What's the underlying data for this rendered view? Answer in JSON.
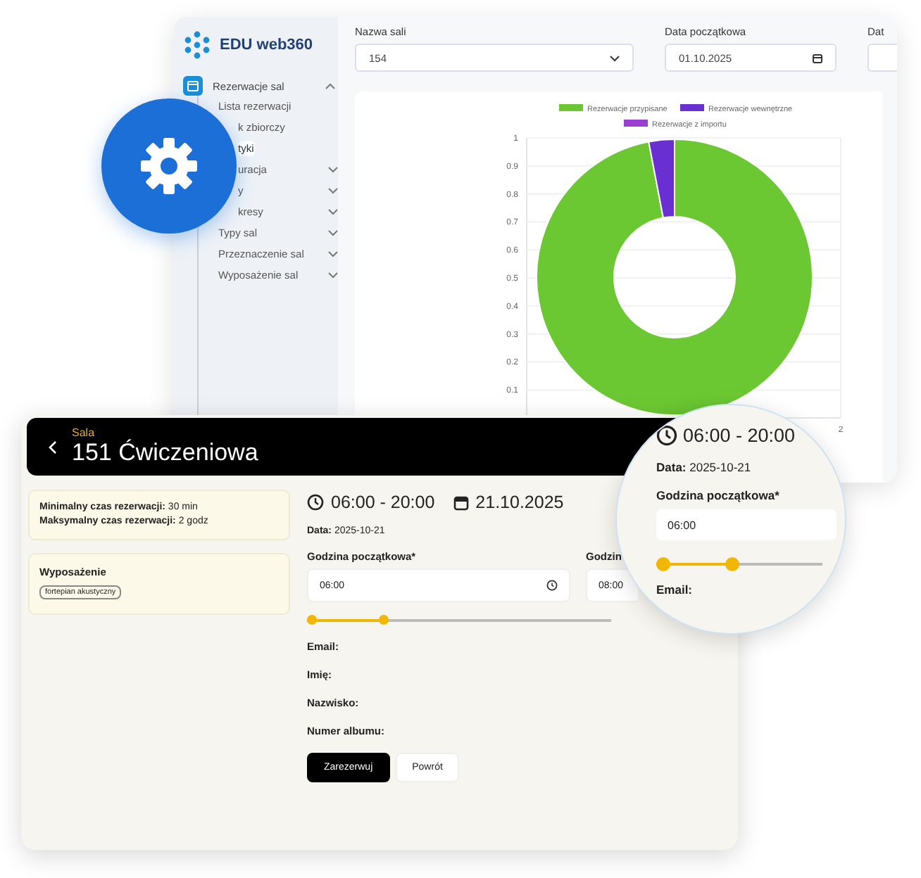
{
  "back_window": {
    "logo": "EDU web360",
    "sidebar": {
      "section": {
        "label": "Rezerwacje sal",
        "expanded": true,
        "children": [
          {
            "kind": "link",
            "label": "Lista rezerwacji",
            "selected": false,
            "covered": false
          },
          {
            "kind": "link",
            "label": "k zbiorczy",
            "selected": false,
            "covered": true
          },
          {
            "kind": "link",
            "label": "tyki",
            "selected": true,
            "covered": true
          },
          {
            "kind": "group",
            "label": "uracja",
            "selected": false,
            "covered": true
          },
          {
            "kind": "group",
            "label": "y",
            "selected": false,
            "covered": true
          },
          {
            "kind": "group",
            "label": "kresy",
            "selected": false,
            "covered": true
          },
          {
            "kind": "group",
            "label": "Typy sal",
            "selected": false,
            "covered": false
          },
          {
            "kind": "group",
            "label": "Przeznaczenie sal",
            "selected": false,
            "covered": false
          },
          {
            "kind": "group",
            "label": "Wyposażenie sal",
            "selected": false,
            "covered": false
          }
        ]
      }
    },
    "filters": [
      {
        "kind": "select",
        "label": "Nazwa sali",
        "value": "154"
      },
      {
        "kind": "date",
        "label": "Data początkowa",
        "value": "01.10.2025"
      },
      {
        "kind": "cut",
        "label": "Dat"
      }
    ],
    "chart": {
      "chart_data": {
        "type": "donut",
        "categories": [
          "Rezerwacje przypisane",
          "Rezerwacje wewnętrzne",
          "Rezerwacje z importu"
        ],
        "colors": [
          "#6cc832",
          "#6a2fd0",
          "#9b3fd0"
        ],
        "values": [
          0.97,
          0.03,
          0
        ],
        "legend": "top"
      },
      "axis_ticks": [
        "1",
        "0.9",
        "0.8",
        "0.7",
        "0.6",
        "0.5",
        "0.4",
        "0.3",
        "0.2",
        "0.1"
      ],
      "corner_tick": "2"
    }
  },
  "front_window": {
    "header": {
      "subtitle": "Sala",
      "title": "151 Ćwiczeniowa"
    },
    "info_cards": [
      {
        "kind": "limits",
        "lines": [
          "**Minimalny czas rezerwacji:** 30 min",
          "**Maksymalny czas rezerwacji:** 2 godz"
        ]
      },
      {
        "kind": "equipment",
        "title": "Wyposażenie",
        "tags": [
          "fortepian akustyczny"
        ]
      }
    ],
    "hours": "06:00 - 20:00",
    "date": "21.10.2025",
    "date_line": "**Data:** 2025-10-21",
    "time_fields": [
      {
        "label": "Godzina początkowa*",
        "value": "06:00"
      },
      {
        "label": "Godzin",
        "value": "08:00"
      }
    ],
    "slider": {
      "level": 0.25
    },
    "fields": [
      "Email:",
      "Imię:",
      "Nazwisko:",
      "Numer albumu:"
    ],
    "buttons": [
      {
        "kind": "primary",
        "label": "Zarezerwuj"
      },
      {
        "kind": "secondary",
        "label": "Powrót"
      }
    ]
  },
  "magnifier": {
    "hours": "06:00 - 20:00",
    "date_line": "**Data:** 2025-10-21",
    "start_label": "Godzina początkowa*",
    "start_value": "06:00",
    "slider": {
      "level": 0.46
    },
    "next_label": "Email:"
  }
}
